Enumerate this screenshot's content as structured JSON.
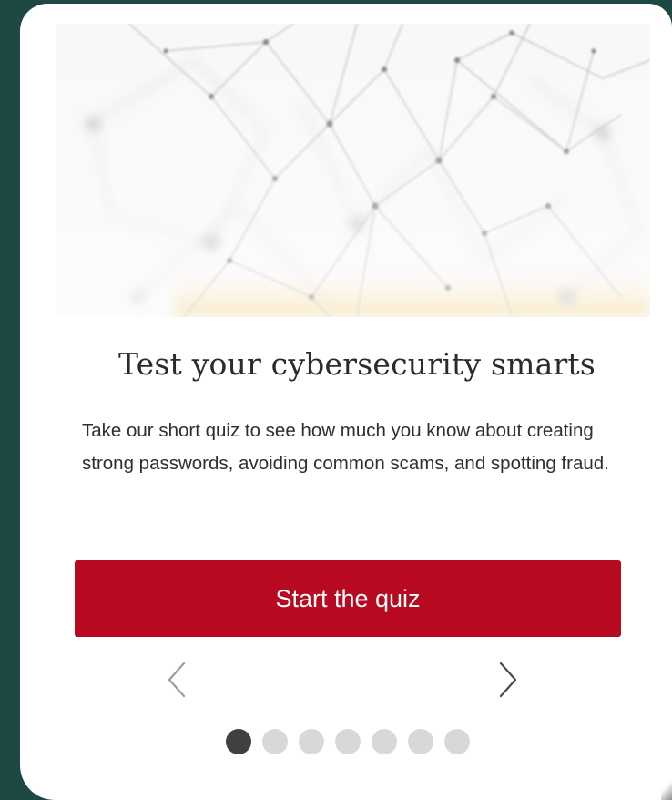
{
  "card": {
    "hero_image": "network-nodes-illustration",
    "title": "Test your cybersecurity smarts",
    "description": "Take our short quiz to see how much you know about creating strong passwords, avoiding common scams, and spotting fraud.",
    "cta_label": "Start the quiz"
  },
  "carousel": {
    "prev_icon": "chevron-left-icon",
    "next_icon": "chevron-right-icon",
    "total_slides": 7,
    "active_slide": 1
  },
  "colors": {
    "background": "#1d4843",
    "card": "#ffffff",
    "cta": "#b70a21",
    "dot_active": "#404040",
    "dot_inactive": "#d8d8d8",
    "hero_accent": "#f2c76a"
  }
}
